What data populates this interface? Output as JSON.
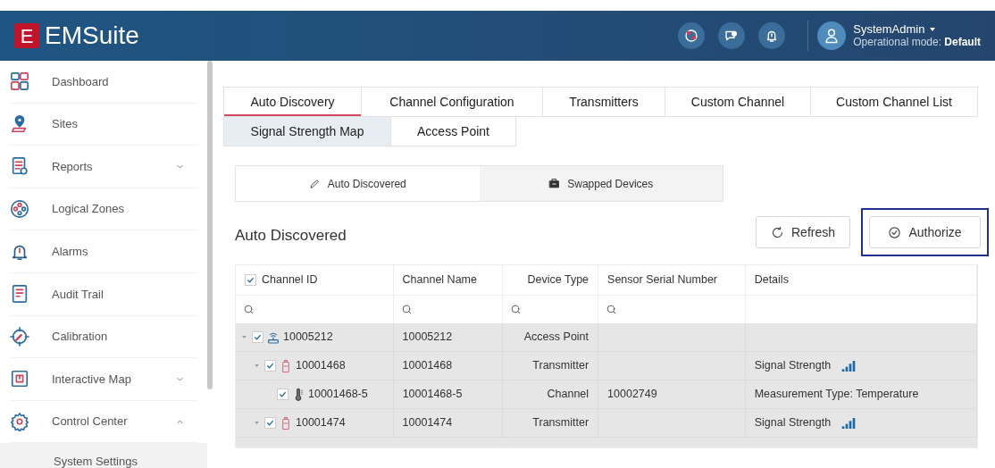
{
  "header": {
    "logo_letter": "E",
    "app_name": "EMSuite",
    "user": "SystemAdmin",
    "mode_label": "Operational mode: **Default**"
  },
  "sidebar": {
    "items": [
      {
        "label": "Dashboard"
      },
      {
        "label": "Sites"
      },
      {
        "label": "Reports",
        "expanded": false
      },
      {
        "label": "Logical Zones"
      },
      {
        "label": "Alarms"
      },
      {
        "label": "Audit Trail"
      },
      {
        "label": "Calibration"
      },
      {
        "label": "Interactive Map",
        "expanded": false
      },
      {
        "label": "Control Center",
        "expanded": true,
        "children": [
          {
            "label": "System Settings",
            "selected": true
          }
        ]
      }
    ]
  },
  "tabs": [
    [
      {
        "label": "Auto Discovery",
        "selected": true,
        "highlighted": false
      },
      {
        "label": "Channel Configuration",
        "selected": false,
        "highlighted": false
      },
      {
        "label": "Transmitters",
        "selected": false,
        "highlighted": false
      },
      {
        "label": "Custom Channel",
        "selected": false,
        "highlighted": false
      },
      {
        "label": "Custom Channel List",
        "selected": false,
        "highlighted": false
      }
    ],
    [
      {
        "label": "Signal Strength Map",
        "selected": false,
        "highlighted": true
      },
      {
        "label": "Access Point",
        "selected": false,
        "highlighted": false
      }
    ]
  ],
  "subtabs": [
    {
      "label": "Auto Discovered",
      "selected": true
    },
    {
      "label": "Swapped Devices",
      "selected": false
    }
  ],
  "section_title": "Auto Discovered",
  "actions": [
    {
      "label": "Refresh",
      "outlined": false
    },
    {
      "label": "Authorize",
      "outlined": true
    }
  ],
  "table": {
    "header_checked": true,
    "columns": [
      "Channel ID",
      "Channel Name",
      "Device Type",
      "Sensor Serial Number",
      "Details"
    ],
    "rows": [
      {
        "kind": "access_point",
        "checked": true,
        "expanded": true,
        "cells": [
          "10005212",
          "10005212",
          "Access Point",
          "",
          ""
        ],
        "signal": false,
        "children": [
          {
            "kind": "transmitter",
            "checked": true,
            "expanded": true,
            "cells": [
              "10001468",
              "10001468",
              "Transmitter",
              "",
              "Signal Strength"
            ],
            "signal": true,
            "children": [
              {
                "kind": "channel",
                "checked": true,
                "cells": [
                  "10001468-5",
                  "10001468-5",
                  "Channel",
                  "10002749",
                  "Measurement Type: Temperature"
                ],
                "signal": false
              }
            ]
          },
          {
            "kind": "transmitter",
            "checked": true,
            "expanded": true,
            "cells": [
              "10001474",
              "10001474",
              "Transmitter",
              "",
              "Signal Strength"
            ],
            "signal": true
          }
        ]
      }
    ]
  }
}
